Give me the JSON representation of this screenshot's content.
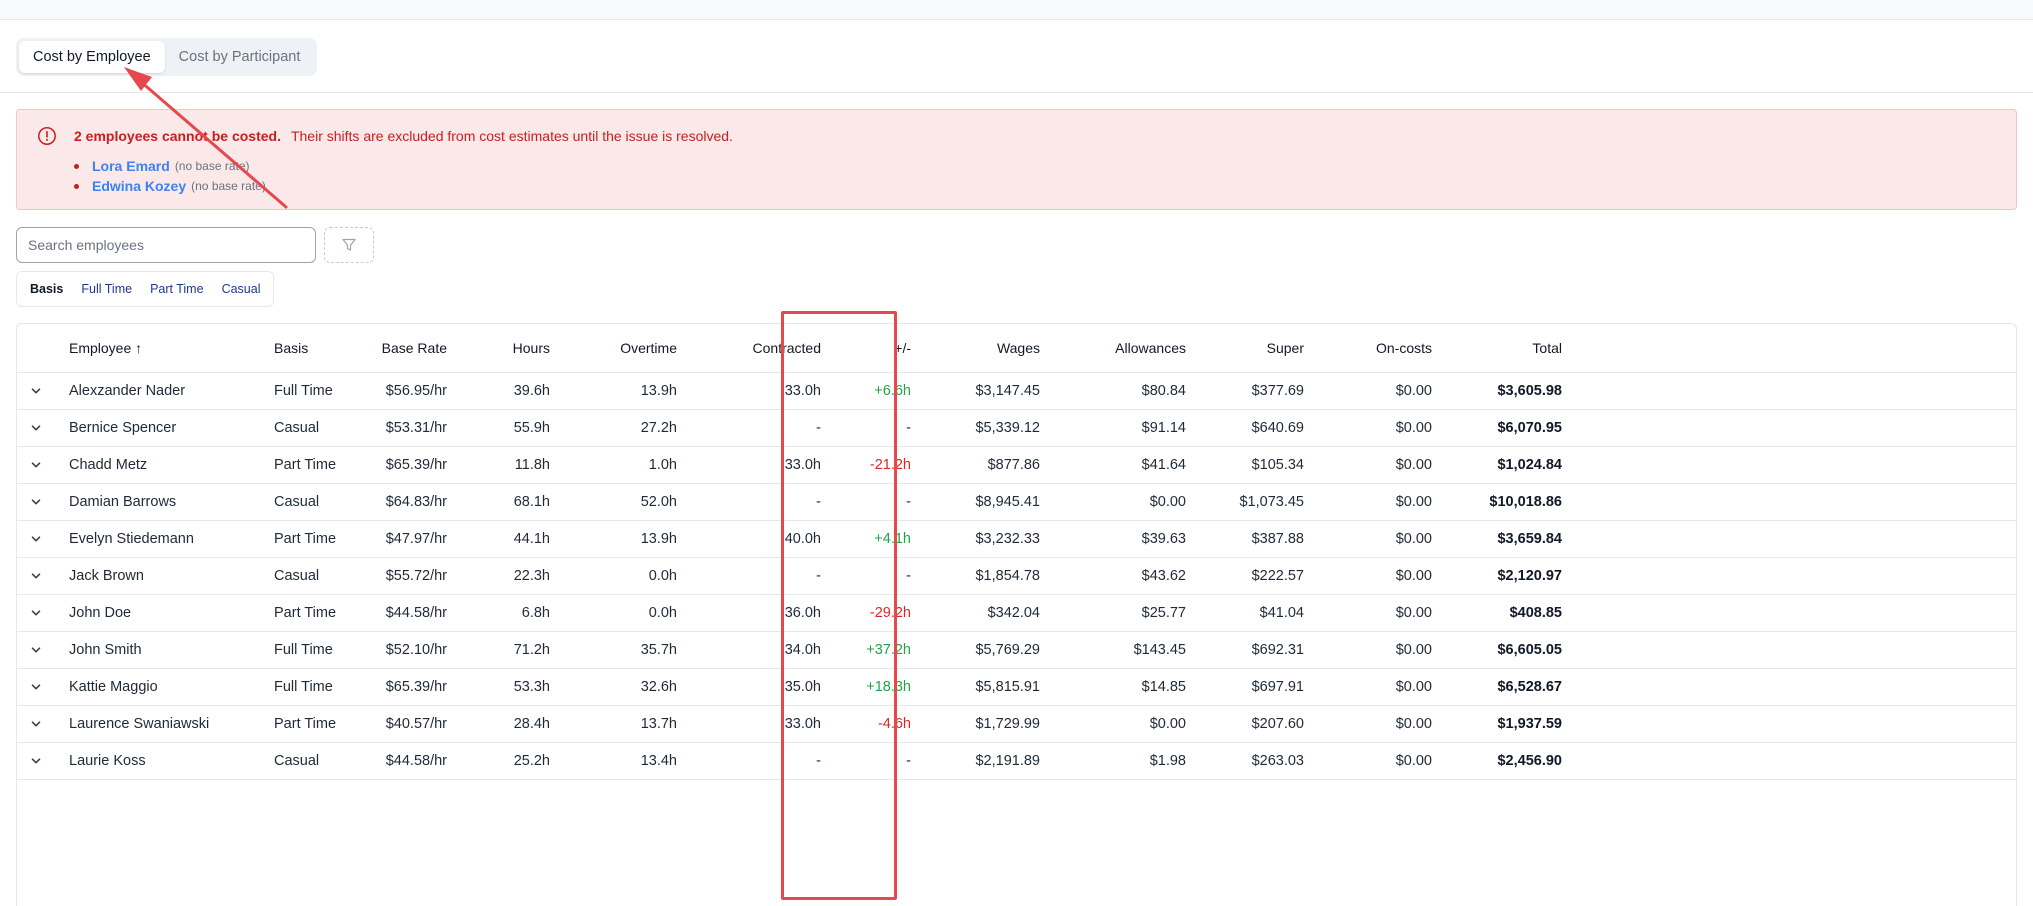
{
  "tabs": [
    {
      "label": "Cost by Employee",
      "active": true
    },
    {
      "label": "Cost by Participant",
      "active": false
    }
  ],
  "alert": {
    "headline_bold": "2 employees cannot be costed.",
    "message": "Their shifts are excluded from cost estimates until the issue is resolved.",
    "icon": "alert-circle-icon",
    "items": [
      {
        "name": "Lora Emard",
        "reason": "(no base rate)"
      },
      {
        "name": "Edwina Kozey",
        "reason": "(no base rate)"
      }
    ]
  },
  "search": {
    "placeholder": "Search employees",
    "value": ""
  },
  "filter": {
    "icon": "filter-icon"
  },
  "basis_filter": [
    "Basis",
    "Full Time",
    "Part Time",
    "Casual"
  ],
  "table": {
    "columns": [
      "Employee ↑",
      "Basis",
      "Base Rate",
      "Hours",
      "Overtime",
      "Contracted",
      "+/-",
      "Wages",
      "Allowances",
      "Super",
      "On-costs",
      "Total"
    ],
    "rows": [
      {
        "employee": "Alexzander Nader",
        "basis": "Full Time",
        "base_rate": "$56.95/hr",
        "hours": "39.6h",
        "overtime": "13.9h",
        "contracted": "33.0h",
        "diff": "+6.6h",
        "wages": "$3,147.45",
        "allowances": "$80.84",
        "super": "$377.69",
        "oncosts": "$0.00",
        "total": "$3,605.98"
      },
      {
        "employee": "Bernice Spencer",
        "basis": "Casual",
        "base_rate": "$53.31/hr",
        "hours": "55.9h",
        "overtime": "27.2h",
        "contracted": "-",
        "diff": "-",
        "wages": "$5,339.12",
        "allowances": "$91.14",
        "super": "$640.69",
        "oncosts": "$0.00",
        "total": "$6,070.95"
      },
      {
        "employee": "Chadd Metz",
        "basis": "Part Time",
        "base_rate": "$65.39/hr",
        "hours": "11.8h",
        "overtime": "1.0h",
        "contracted": "33.0h",
        "diff": "-21.2h",
        "wages": "$877.86",
        "allowances": "$41.64",
        "super": "$105.34",
        "oncosts": "$0.00",
        "total": "$1,024.84"
      },
      {
        "employee": "Damian Barrows",
        "basis": "Casual",
        "base_rate": "$64.83/hr",
        "hours": "68.1h",
        "overtime": "52.0h",
        "contracted": "-",
        "diff": "-",
        "wages": "$8,945.41",
        "allowances": "$0.00",
        "super": "$1,073.45",
        "oncosts": "$0.00",
        "total": "$10,018.86"
      },
      {
        "employee": "Evelyn Stiedemann",
        "basis": "Part Time",
        "base_rate": "$47.97/hr",
        "hours": "44.1h",
        "overtime": "13.9h",
        "contracted": "40.0h",
        "diff": "+4.1h",
        "wages": "$3,232.33",
        "allowances": "$39.63",
        "super": "$387.88",
        "oncosts": "$0.00",
        "total": "$3,659.84"
      },
      {
        "employee": "Jack Brown",
        "basis": "Casual",
        "base_rate": "$55.72/hr",
        "hours": "22.3h",
        "overtime": "0.0h",
        "contracted": "-",
        "diff": "-",
        "wages": "$1,854.78",
        "allowances": "$43.62",
        "super": "$222.57",
        "oncosts": "$0.00",
        "total": "$2,120.97"
      },
      {
        "employee": "John Doe",
        "basis": "Part Time",
        "base_rate": "$44.58/hr",
        "hours": "6.8h",
        "overtime": "0.0h",
        "contracted": "36.0h",
        "diff": "-29.2h",
        "wages": "$342.04",
        "allowances": "$25.77",
        "super": "$41.04",
        "oncosts": "$0.00",
        "total": "$408.85"
      },
      {
        "employee": "John Smith",
        "basis": "Full Time",
        "base_rate": "$52.10/hr",
        "hours": "71.2h",
        "overtime": "35.7h",
        "contracted": "34.0h",
        "diff": "+37.2h",
        "wages": "$5,769.29",
        "allowances": "$143.45",
        "super": "$692.31",
        "oncosts": "$0.00",
        "total": "$6,605.05"
      },
      {
        "employee": "Kattie Maggio",
        "basis": "Full Time",
        "base_rate": "$65.39/hr",
        "hours": "53.3h",
        "overtime": "32.6h",
        "contracted": "35.0h",
        "diff": "+18.3h",
        "wages": "$5,815.91",
        "allowances": "$14.85",
        "super": "$697.91",
        "oncosts": "$0.00",
        "total": "$6,528.67"
      },
      {
        "employee": "Laurence Swaniawski",
        "basis": "Part Time",
        "base_rate": "$40.57/hr",
        "hours": "28.4h",
        "overtime": "13.7h",
        "contracted": "33.0h",
        "diff": "-4.6h",
        "wages": "$1,729.99",
        "allowances": "$0.00",
        "super": "$207.60",
        "oncosts": "$0.00",
        "total": "$1,937.59"
      },
      {
        "employee": "Laurie Koss",
        "basis": "Casual",
        "base_rate": "$44.58/hr",
        "hours": "25.2h",
        "overtime": "13.4h",
        "contracted": "-",
        "diff": "-",
        "wages": "$2,191.89",
        "allowances": "$1.98",
        "super": "$263.03",
        "oncosts": "$0.00",
        "total": "$2,456.90"
      }
    ]
  },
  "colors": {
    "alert_bg": "#fbe9e9",
    "alert_text": "#c81e1e",
    "link": "#3b82f6",
    "positive": "#22a447",
    "negative": "#dc2626",
    "annotation": "#e5484d"
  }
}
